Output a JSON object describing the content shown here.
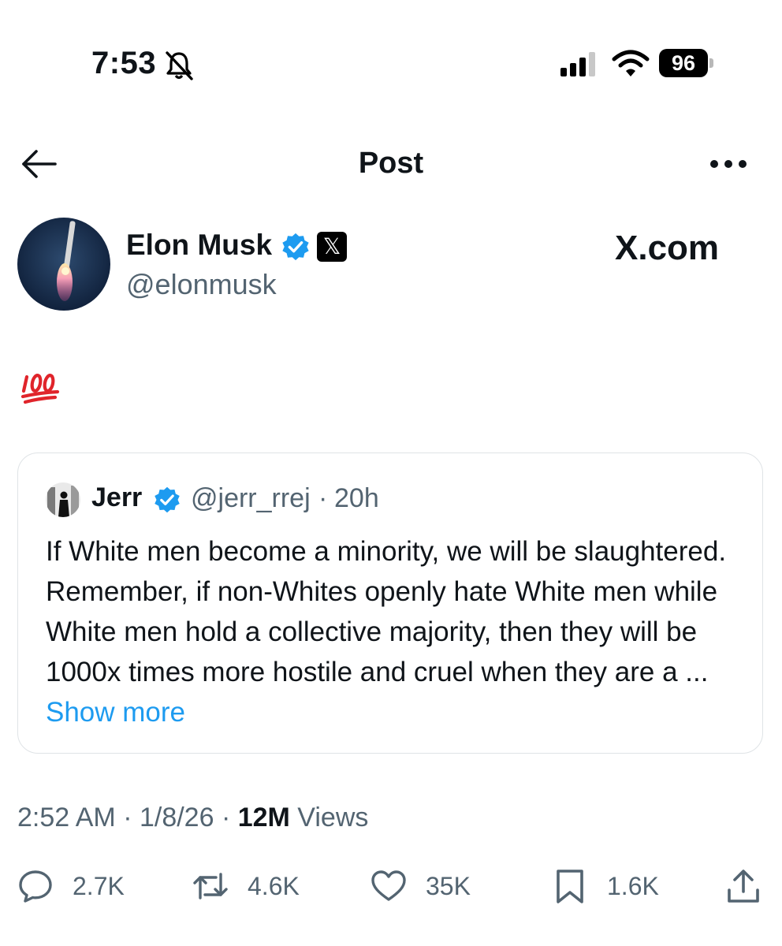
{
  "status_bar": {
    "time": "7:53",
    "battery": "96"
  },
  "header": {
    "title": "Post"
  },
  "author": {
    "name": "Elon Musk",
    "handle": "@elonmusk",
    "affiliate_label": "X.com"
  },
  "post": {
    "text_icon": "hundred-points-emoji"
  },
  "quote": {
    "name": "Jerr",
    "handle": "@jerr_rrej",
    "separator": "·",
    "time": "20h",
    "text": "If White men become a minority, we will be slaughtered. Remember, if non-Whites openly hate White men while White men hold a collective majority, then they will be 1000x times more hostile and cruel when they are a ...",
    "show_more": "Show more"
  },
  "meta": {
    "time": "2:52 AM",
    "sep1": " · ",
    "date": "1/8/26",
    "sep2": " · ",
    "views_count": "12M",
    "views_label": " Views"
  },
  "actions": {
    "reply": "2.7K",
    "repost": "4.6K",
    "like": "35K",
    "bookmark": "1.6K"
  },
  "colors": {
    "accent": "#1d9bf0",
    "secondary_text": "#536471",
    "primary_text": "#0f1419"
  }
}
